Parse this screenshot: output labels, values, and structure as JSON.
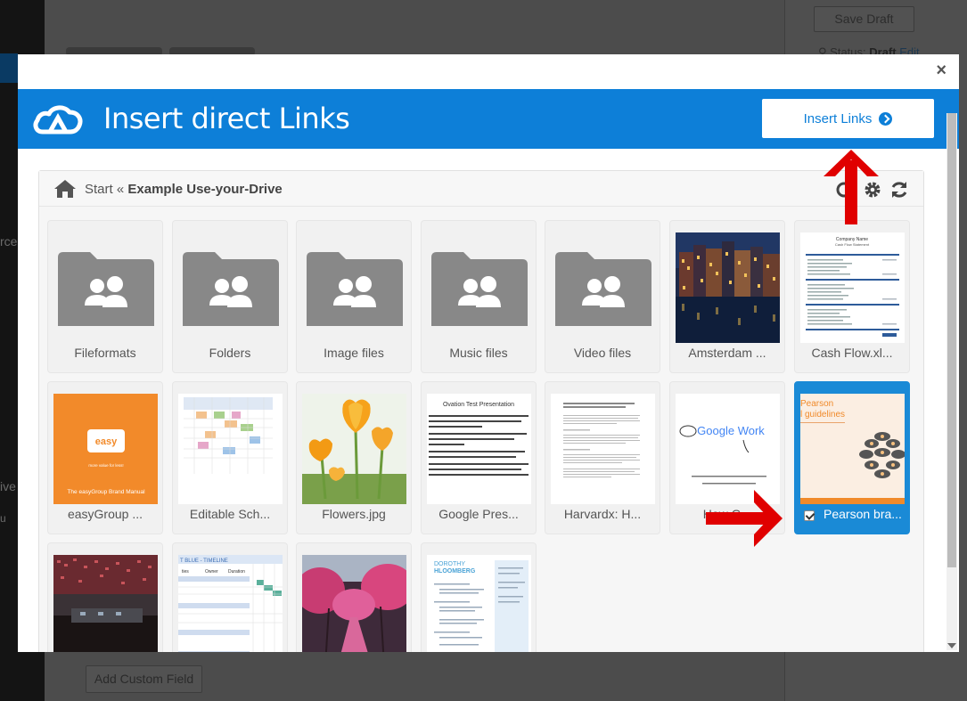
{
  "background": {
    "save_draft": "Save Draft",
    "status_label": "Status:",
    "status_value": "Draft",
    "status_edit": "Edit",
    "add_custom_field": "Add Custom Field",
    "left_fragments": [
      "rce",
      "ive",
      "u"
    ]
  },
  "modal": {
    "close_symbol": "×",
    "title": "Insert direct Links",
    "insert_button": "Insert Links",
    "breadcrumb": {
      "start": "Start",
      "separator": " « ",
      "current": "Example Use-your-Drive"
    },
    "items": [
      {
        "label": "Fileformats",
        "kind": "folder"
      },
      {
        "label": "Folders",
        "kind": "folder"
      },
      {
        "label": "Image files",
        "kind": "folder"
      },
      {
        "label": "Music files",
        "kind": "folder"
      },
      {
        "label": "Video files",
        "kind": "folder"
      },
      {
        "label": "Amsterdam ...",
        "kind": "image"
      },
      {
        "label": "Cash Flow.xl...",
        "kind": "spreadsheet"
      },
      {
        "label": "easyGroup ...",
        "kind": "image"
      },
      {
        "label": "Editable Sch...",
        "kind": "spreadsheet"
      },
      {
        "label": "Flowers.jpg",
        "kind": "image"
      },
      {
        "label": "Google Pres...",
        "kind": "document"
      },
      {
        "label": "Harvardx: H...",
        "kind": "document"
      },
      {
        "label": "How G...",
        "kind": "image"
      },
      {
        "label": "Pearson bra...",
        "kind": "document",
        "selected": true
      },
      {
        "label": "",
        "kind": "image"
      },
      {
        "label": "",
        "kind": "spreadsheet"
      },
      {
        "label": "",
        "kind": "image"
      },
      {
        "label": "",
        "kind": "document"
      }
    ],
    "thumb_text": {
      "cashflow_title": "Company Name",
      "cashflow_sub": "Cash Flow Statement",
      "easy_logo": "easy",
      "easy_tag": "more value for less!",
      "easy_footer": "The easyGroup Brand Manual",
      "ovation_title": "Ovation Test Presentation",
      "google_work": "Google Work",
      "pearson_line1": "Pearson",
      "pearson_line2": "l guidelines",
      "timeline_header": "T BLUE - TIMELINE",
      "timeline_col1": "ties",
      "timeline_col2": "Owner",
      "timeline_col3": "Duration",
      "resume_name1": "DOROTHY",
      "resume_name2": "HLOOMBERG"
    }
  },
  "colors": {
    "header_blue": "#0d7fd8",
    "selected_tile": "#1a8ad6",
    "annotation_red": "#e00000",
    "folder_gray": "#888888"
  }
}
